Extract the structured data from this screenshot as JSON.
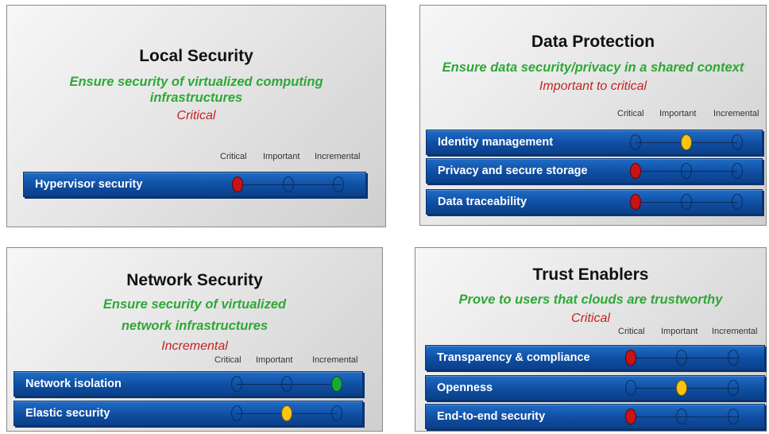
{
  "levels": [
    "Critical",
    "Important",
    "Incremental"
  ],
  "colors": {
    "title": "#111111",
    "subtitle": "#2ea836",
    "level_text": "#c42222",
    "bar": "#1456b0",
    "critical": "#c81414",
    "important": "#ffc312",
    "incremental": "#19a83a"
  },
  "panels": [
    {
      "title": "Local Security",
      "subtitle_lines": [
        "Ensure security of virtualized computing",
        "infrastructures"
      ],
      "level": "Critical",
      "rows": [
        {
          "label": "Hypervisor security",
          "rating": "Critical"
        }
      ]
    },
    {
      "title": "Data Protection",
      "subtitle_lines": [
        "Ensure data security/privacy in a shared context"
      ],
      "level": "Important to critical",
      "rows": [
        {
          "label": "Identity management",
          "rating": "Important"
        },
        {
          "label": "Privacy and secure storage",
          "rating": "Critical"
        },
        {
          "label": "Data traceability",
          "rating": "Critical"
        }
      ]
    },
    {
      "title": "Network Security",
      "subtitle_lines": [
        "Ensure security of virtualized",
        "network infrastructures"
      ],
      "level": "Incremental",
      "rows": [
        {
          "label": "Network isolation",
          "rating": "Incremental"
        },
        {
          "label": "Elastic security",
          "rating": "Important"
        }
      ]
    },
    {
      "title": "Trust Enablers",
      "subtitle_lines": [
        "Prove to users that clouds are trustworthy"
      ],
      "level": "Critical",
      "rows": [
        {
          "label": "Transparency & compliance",
          "rating": "Critical"
        },
        {
          "label": "Openness",
          "rating": "Important"
        },
        {
          "label": "End-to-end security",
          "rating": "Critical"
        }
      ]
    }
  ]
}
